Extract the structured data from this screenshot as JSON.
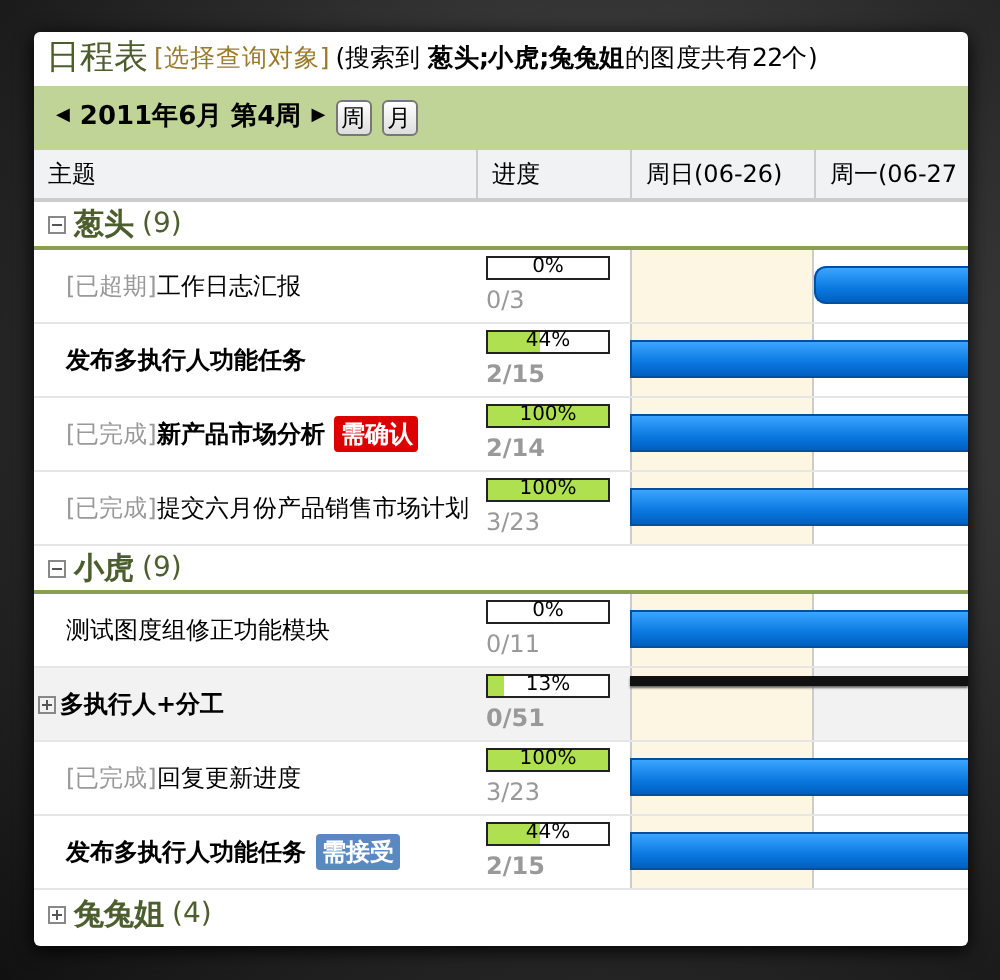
{
  "title": "日程表",
  "query_link": "[选择查询对象]",
  "summary": "(搜索到 **葱头;小虎;兔兔姐**的图度共有22个)",
  "toolbar": {
    "prev": "◀",
    "period": "2011年6月 第4周",
    "next": "▶",
    "buttons": [
      "周",
      "月"
    ]
  },
  "columns": [
    "主题",
    "进度",
    "周日(06-26)",
    "周一(06-27"
  ],
  "groups": [
    {
      "name": "葱头",
      "count": "(9)",
      "expanded": true,
      "tasks": [
        {
          "kind": "task",
          "status": "[已超期]",
          "title": "工作日志汇报",
          "bold": false,
          "percent": "0%",
          "level": 0,
          "count": "0/3",
          "bar": {
            "kind": "starting"
          }
        },
        {
          "kind": "task",
          "title": "发布多执行人功能任务",
          "bold": true,
          "percent": "44%",
          "level": 0.44,
          "count": "2/15",
          "bar": {
            "kind": "continuing"
          }
        },
        {
          "kind": "task",
          "status": "[已完成]",
          "title": "新产品市场分析",
          "bold": true,
          "tag": {
            "text": "需确认",
            "color": "#dd0000"
          },
          "percent": "100%",
          "level": 1,
          "count": "2/14",
          "bar": {
            "kind": "continuing"
          }
        },
        {
          "kind": "task",
          "status": "[已完成]",
          "title": "提交六月份产品销售市场计划",
          "bold": false,
          "percent": "100%",
          "level": 1,
          "count": "3/23",
          "bar": {
            "kind": "continuing"
          }
        }
      ]
    },
    {
      "name": "小虎",
      "count": "(9)",
      "expanded": true,
      "tasks": [
        {
          "kind": "task",
          "title": "测试图度组修正功能模块",
          "bold": false,
          "percent": "0%",
          "level": 0,
          "count": "0/11",
          "bar": {
            "kind": "continuing"
          }
        },
        {
          "kind": "summary",
          "expanded": false,
          "title": "多执行人+分工",
          "bold": true,
          "percent": "13%",
          "level": 0.13,
          "count": "0/51",
          "bar": {
            "kind": "summary"
          }
        },
        {
          "kind": "task",
          "status": "[已完成]",
          "title": "回复更新进度",
          "bold": false,
          "percent": "100%",
          "level": 1,
          "count": "3/23",
          "bar": {
            "kind": "continuing"
          }
        },
        {
          "kind": "task",
          "title": "发布多执行人功能任务",
          "bold": true,
          "tag": {
            "text": "需接受",
            "color": "#5a88c0"
          },
          "percent": "44%",
          "level": 0.44,
          "count": "2/15",
          "bar": {
            "kind": "continuing"
          }
        }
      ]
    },
    {
      "name": "兔兔姐",
      "count": "(4)",
      "expanded": false
    }
  ]
}
